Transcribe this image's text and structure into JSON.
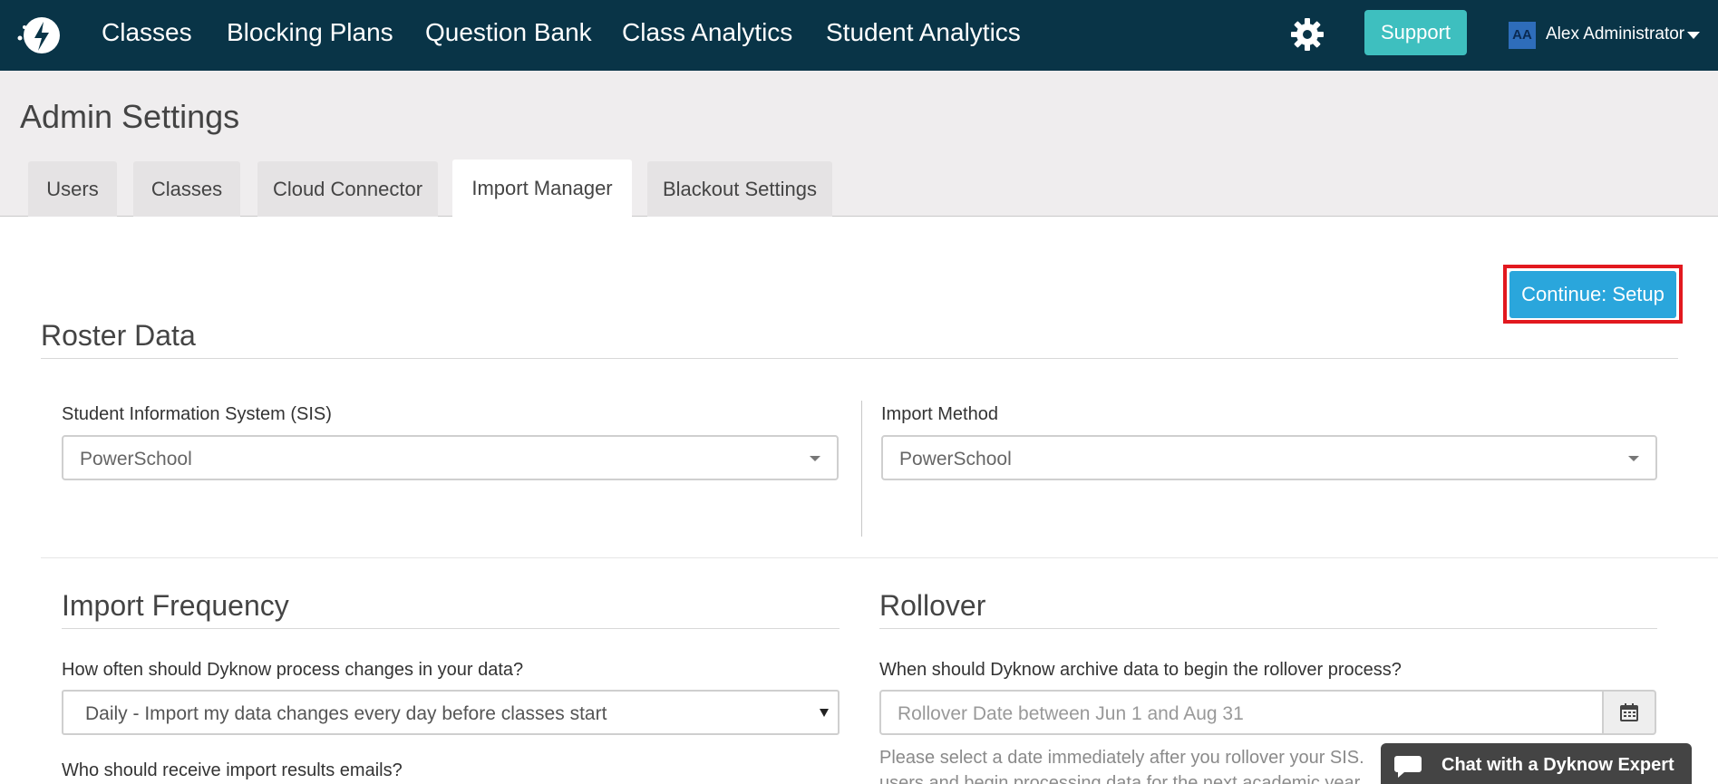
{
  "nav": {
    "items": [
      "Classes",
      "Blocking Plans",
      "Question Bank",
      "Class Analytics",
      "Student Analytics"
    ],
    "support_label": "Support",
    "user_initials": "AA",
    "user_name": "Alex Administrator",
    "icons": {
      "logo": "dyknow-logo-icon",
      "settings": "gear-icon",
      "user_menu": "chevron-down-icon"
    },
    "bg_color": "#093447",
    "support_color": "#3ebfbf"
  },
  "page": {
    "title": "Admin Settings",
    "tabs": [
      "Users",
      "Classes",
      "Cloud Connector",
      "Import Manager",
      "Blackout Settings"
    ],
    "active_tab": "Import Manager"
  },
  "continue_label": "Continue: Setup",
  "roster": {
    "title": "Roster Data",
    "sis_label": "Student Information System (SIS)",
    "sis_value": "PowerSchool",
    "method_label": "Import Method",
    "method_value": "PowerSchool"
  },
  "frequency": {
    "title": "Import Frequency",
    "question": "How often should Dyknow process changes in your data?",
    "value": "Daily - Import my data changes every day before classes start",
    "emails_label": "Who should receive import results emails?"
  },
  "rollover": {
    "title": "Rollover",
    "question": "When should Dyknow archive data to begin the rollover process?",
    "placeholder": "Rollover Date between Jun 1 and Aug 31",
    "help_line1": "Please select a date immediately after you rollover your SIS.",
    "help_line2": "users and begin processing data for the next academic year",
    "calendar_icon": "calendar-icon"
  },
  "chat": {
    "label": "Chat with a Dyknow Expert",
    "icon": "chat-bubble-icon"
  },
  "colors": {
    "primary_button": "#2aa6dc",
    "highlight_outline": "#e2181f"
  }
}
